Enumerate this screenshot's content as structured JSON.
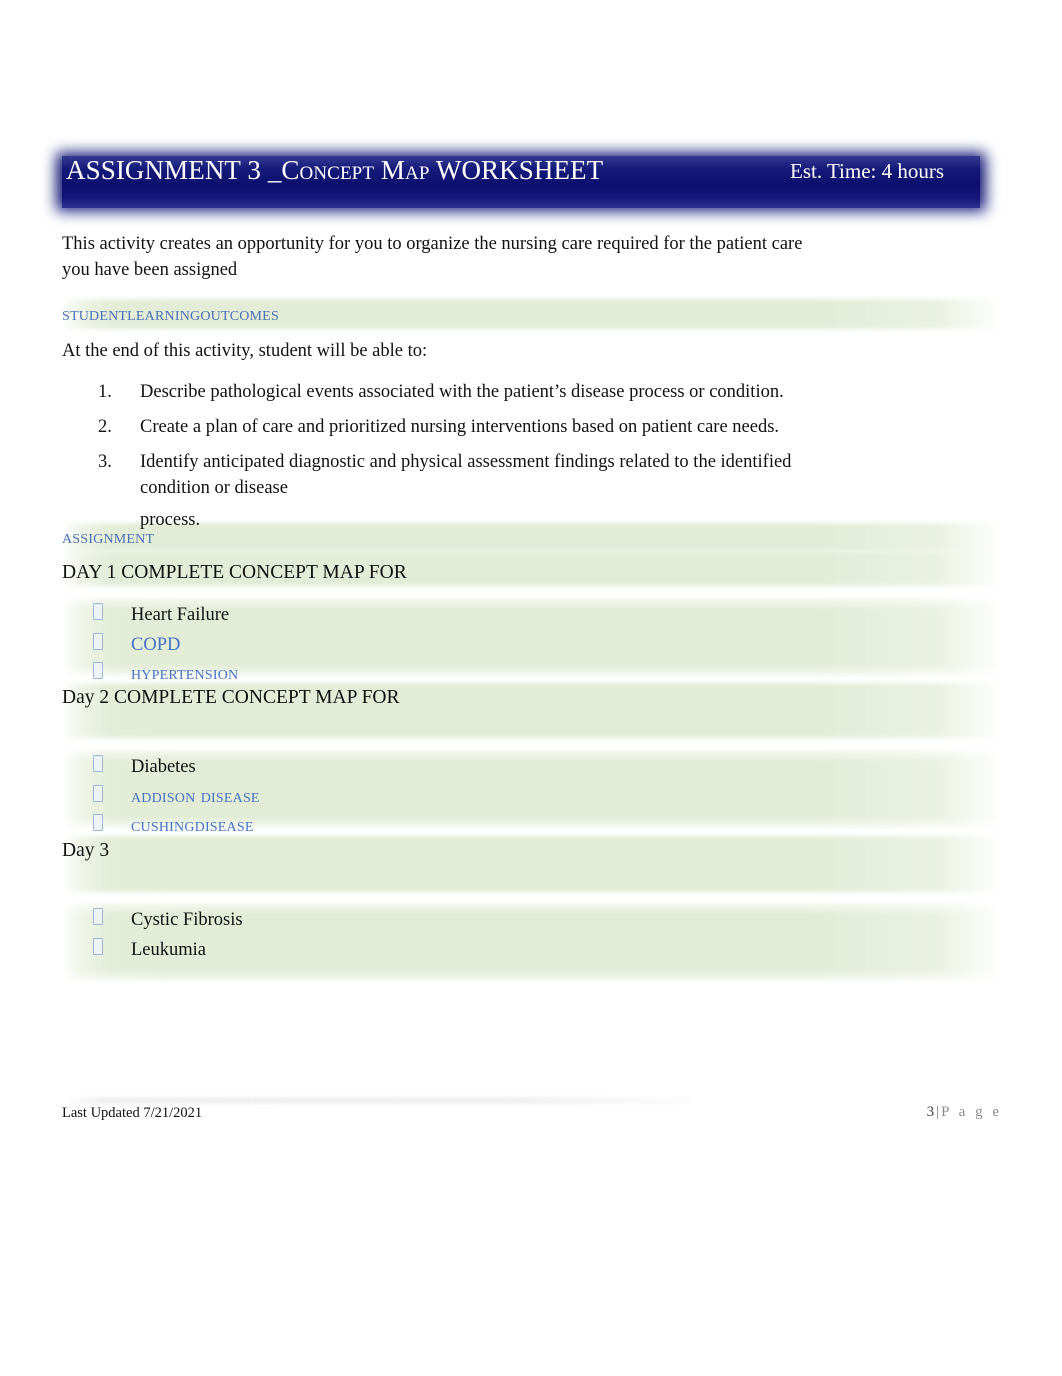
{
  "header": {
    "title_prefix": "ASSIGNMENT 3 _C",
    "title_sc1": "oncept",
    "title_m": " M",
    "title_sc2": "ap",
    "title_suffix": " WORKSHEET",
    "est_time": "Est. Time: 4 hours",
    "bar_color": "#0c0f6c",
    "text_color": "#ffffff"
  },
  "intro": {
    "paragraph": "This activity creates an opportunity for you to organize the nursing care required for the patient care you have been assigned"
  },
  "outcomes_section": {
    "heading": "StudentLearningOutcomes",
    "lead_in": "At the end of this activity, student will be able to:",
    "items": [
      {
        "number": "1.",
        "text": "Describe pathological events associated with the patient’s disease process or condition.",
        "continuation": "",
        "continuation2": ""
      },
      {
        "number": "2.",
        "text": "Create a plan of care and prioritized nursing interventions based on patient care needs.",
        "continuation": "",
        "continuation2": ""
      },
      {
        "number": "3.",
        "text": "Identify anticipated diagnostic and physical assessment findings related to the identified",
        "continuation": "condition or disease",
        "continuation2": "process."
      }
    ]
  },
  "assignment_section": {
    "heading": "Assignment",
    "heading_color": "#4a6fb5",
    "band_color": "#e2ecd6",
    "days": [
      {
        "day_heading": "DAY 1 COMPLETE CONCEPT MAP FOR",
        "conditions": [
          {
            "bullet": "tofu-bullet-icon",
            "label": "Heart Failure",
            "style": "plain"
          },
          {
            "bullet": "tofu-bullet-icon",
            "label": "COPD",
            "style": "blue"
          },
          {
            "bullet": "tofu-bullet-icon",
            "label": "Hypertension",
            "style": "blue-smallcaps"
          }
        ]
      },
      {
        "day_heading": "Day 2 COMPLETE CONCEPT MAP FOR",
        "conditions": [
          {
            "bullet": "tofu-bullet-icon",
            "label": "Diabetes",
            "style": "plain"
          },
          {
            "bullet": "tofu-bullet-icon",
            "label": "Addison  disease",
            "style": "blue-smallcaps"
          },
          {
            "bullet": "tofu-bullet-icon",
            "label": "CushingDisease",
            "style": "blue-smallcaps"
          }
        ]
      },
      {
        "day_heading": "Day 3",
        "conditions": [
          {
            "bullet": "tofu-bullet-icon",
            "label": "Cystic Fibrosis",
            "style": "plain"
          },
          {
            "bullet": "tofu-bullet-icon",
            "label": "Leukumia",
            "style": "plain"
          }
        ]
      }
    ]
  },
  "footer": {
    "last_updated": "Last Updated 7/21/2021",
    "page_number": "3",
    "separator": "|",
    "page_word": "P a g e"
  }
}
